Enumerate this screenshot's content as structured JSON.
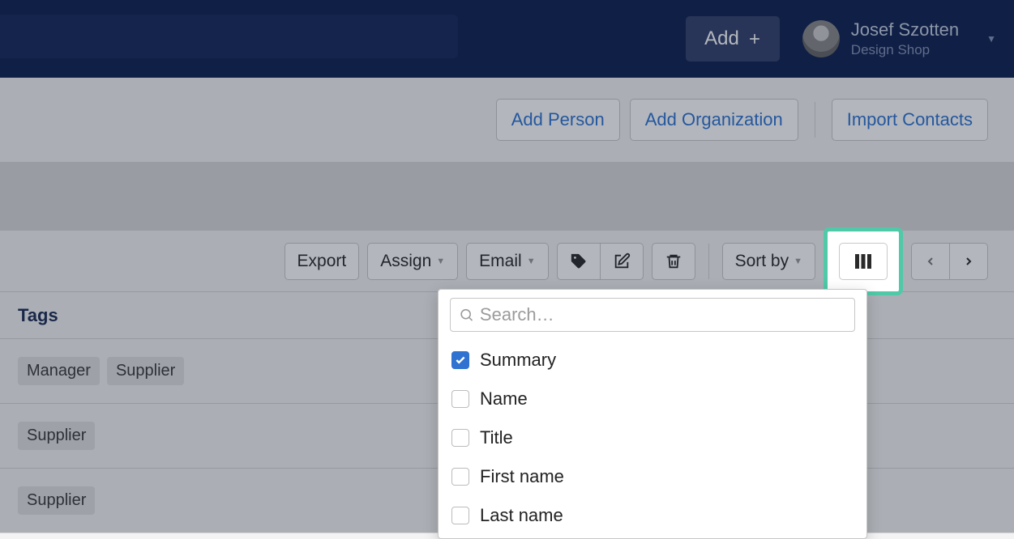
{
  "header": {
    "add_label": "Add",
    "user_name": "Josef Szotten",
    "user_org": "Design Shop"
  },
  "actions": {
    "add_person": "Add Person",
    "add_organization": "Add Organization",
    "import_contacts": "Import Contacts"
  },
  "toolbar": {
    "export": "Export",
    "assign": "Assign",
    "email": "Email",
    "sort_by": "Sort by"
  },
  "columns": {
    "header": "Tags",
    "search_placeholder": "Search…",
    "options": [
      {
        "label": "Summary",
        "checked": true
      },
      {
        "label": "Name",
        "checked": false
      },
      {
        "label": "Title",
        "checked": false
      },
      {
        "label": "First name",
        "checked": false
      },
      {
        "label": "Last name",
        "checked": false
      }
    ]
  },
  "rows": [
    {
      "tags": [
        "Manager",
        "Supplier"
      ]
    },
    {
      "tags": [
        "Supplier"
      ]
    },
    {
      "tags": [
        "Supplier"
      ]
    }
  ]
}
